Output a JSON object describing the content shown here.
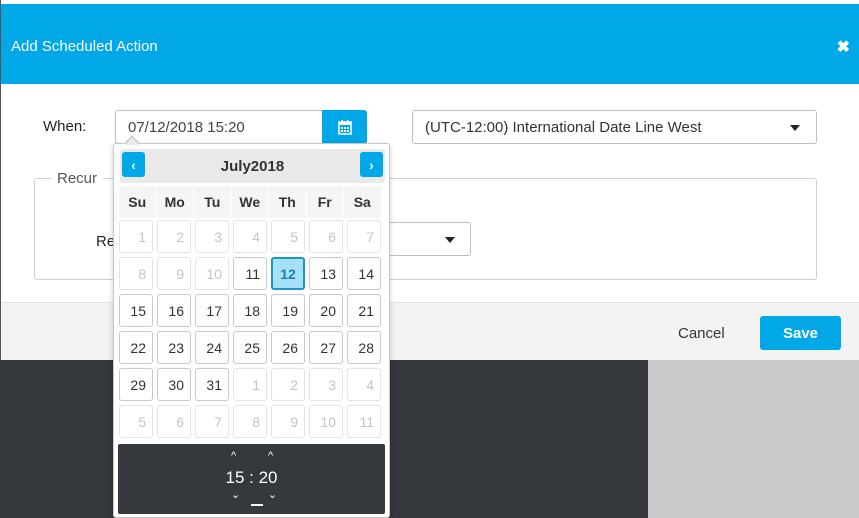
{
  "modal": {
    "title": "Add Scheduled Action",
    "close_symbol": "✖"
  },
  "when": {
    "label": "When:",
    "value": "07/12/2018 15:20",
    "calendar_icon": "calendar-icon"
  },
  "timezone": {
    "selected": "(UTC-12:00) International Date Line West"
  },
  "recurrence": {
    "legend": "Recur",
    "repeat_label": "Re"
  },
  "footer": {
    "cancel_label": "Cancel",
    "save_label": "Save"
  },
  "datepicker": {
    "prev_symbol": "‹",
    "next_symbol": "›",
    "month_label": "July2018",
    "weekdays": [
      "Su",
      "Mo",
      "Tu",
      "We",
      "Th",
      "Fr",
      "Sa"
    ],
    "days": [
      {
        "d": "1",
        "muted": true
      },
      {
        "d": "2",
        "muted": true
      },
      {
        "d": "3",
        "muted": true
      },
      {
        "d": "4",
        "muted": true
      },
      {
        "d": "5",
        "muted": true
      },
      {
        "d": "6",
        "muted": true
      },
      {
        "d": "7",
        "muted": true
      },
      {
        "d": "8",
        "muted": true
      },
      {
        "d": "9",
        "muted": true
      },
      {
        "d": "10",
        "muted": true
      },
      {
        "d": "11",
        "muted": false
      },
      {
        "d": "12",
        "muted": false,
        "selected": true
      },
      {
        "d": "13",
        "muted": false
      },
      {
        "d": "14",
        "muted": false
      },
      {
        "d": "15",
        "muted": false
      },
      {
        "d": "16",
        "muted": false
      },
      {
        "d": "17",
        "muted": false
      },
      {
        "d": "18",
        "muted": false
      },
      {
        "d": "19",
        "muted": false
      },
      {
        "d": "20",
        "muted": false
      },
      {
        "d": "21",
        "muted": false
      },
      {
        "d": "22",
        "muted": false
      },
      {
        "d": "23",
        "muted": false
      },
      {
        "d": "24",
        "muted": false
      },
      {
        "d": "25",
        "muted": false
      },
      {
        "d": "26",
        "muted": false
      },
      {
        "d": "27",
        "muted": false
      },
      {
        "d": "28",
        "muted": false
      },
      {
        "d": "29",
        "muted": false
      },
      {
        "d": "30",
        "muted": false
      },
      {
        "d": "31",
        "muted": false
      },
      {
        "d": "1",
        "muted": true
      },
      {
        "d": "2",
        "muted": true
      },
      {
        "d": "3",
        "muted": true
      },
      {
        "d": "4",
        "muted": true
      },
      {
        "d": "5",
        "muted": true
      },
      {
        "d": "6",
        "muted": true
      },
      {
        "d": "7",
        "muted": true
      },
      {
        "d": "8",
        "muted": true
      },
      {
        "d": "9",
        "muted": true
      },
      {
        "d": "10",
        "muted": true
      },
      {
        "d": "11",
        "muted": true
      }
    ],
    "time": {
      "display": "15 : 20",
      "up_symbol": "^",
      "down_symbol": "⌄"
    }
  },
  "colors": {
    "accent": "#00a8e8",
    "selected_day_bg": "#a6e1f7",
    "time_panel_bg": "#35383c"
  }
}
